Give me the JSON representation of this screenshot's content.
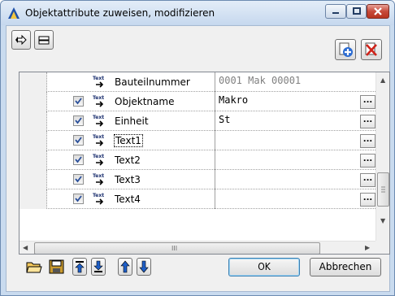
{
  "window": {
    "title": "Objektattribute zuweisen, modifizieren",
    "accent": "#c9dbef"
  },
  "toolbar": {
    "left": [
      {
        "name": "show-tool-icon"
      },
      {
        "name": "hide-tool-icon"
      }
    ],
    "right": [
      {
        "name": "add-attribute-icon"
      },
      {
        "name": "delete-attribute-icon"
      }
    ]
  },
  "table": {
    "rows": [
      {
        "checked": false,
        "icon": "text-attribute-icon",
        "name": "Bauteilnummer",
        "value": "0001 Mak 00001",
        "readonly": true,
        "dots": false
      },
      {
        "checked": true,
        "icon": "text-attribute-icon",
        "name": "Objektname",
        "value": "Makro",
        "readonly": false,
        "dots": true,
        "dots_label": "..."
      },
      {
        "checked": true,
        "icon": "text-attribute-icon",
        "name": "Einheit",
        "value": "St",
        "readonly": false,
        "dots": true,
        "dots_label": "..."
      },
      {
        "checked": true,
        "icon": "text-attribute-icon",
        "name": "Text1",
        "value": "",
        "readonly": false,
        "dots": true,
        "dots_label": "..."
      },
      {
        "checked": true,
        "icon": "text-attribute-icon",
        "name": "Text2",
        "value": "",
        "readonly": false,
        "dots": true,
        "dots_label": "..."
      },
      {
        "checked": true,
        "icon": "text-attribute-icon",
        "name": "Text3",
        "value": "",
        "readonly": false,
        "dots": true,
        "dots_label": "..."
      },
      {
        "checked": true,
        "icon": "text-attribute-icon",
        "name": "Text4",
        "value": "",
        "readonly": false,
        "dots": true,
        "dots_label": "..."
      }
    ],
    "hscroll_label": "III"
  },
  "footer": {
    "icons": [
      "open-folder-icon",
      "save-icon",
      "move-top-icon",
      "move-down-icon",
      "move-up-icon",
      "move-bottom-icon"
    ],
    "ok_label": "OK",
    "cancel_label": "Abbrechen"
  }
}
